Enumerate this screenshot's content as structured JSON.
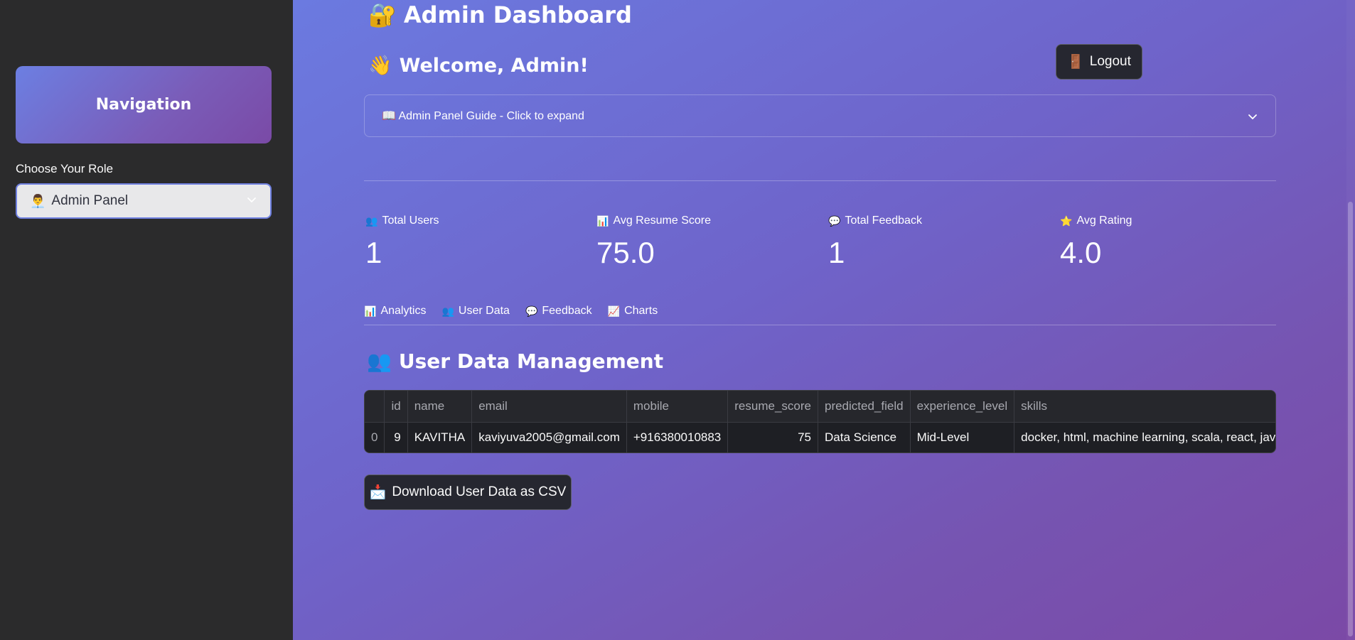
{
  "sidebar": {
    "nav_title": "Navigation",
    "role_label": "Choose Your Role",
    "role_select": {
      "icon": "👨‍💼",
      "value": "Admin Panel"
    }
  },
  "header": {
    "title_icon": "🔐",
    "title": "Admin Dashboard",
    "welcome_icon": "👋",
    "welcome": "Welcome, Admin!",
    "logout_icon": "🚪",
    "logout_label": "Logout"
  },
  "guide": {
    "label": "📖 Admin Panel Guide - Click to expand"
  },
  "metrics": [
    {
      "icon": "👥",
      "label": "Total Users",
      "value": "1"
    },
    {
      "icon": "📊",
      "label": "Avg Resume Score",
      "value": "75.0"
    },
    {
      "icon": "💬",
      "label": "Total Feedback",
      "value": "1"
    },
    {
      "icon": "⭐",
      "label": "Avg Rating",
      "value": "4.0"
    }
  ],
  "tabs": [
    {
      "icon": "📊",
      "label": "Analytics"
    },
    {
      "icon": "👥",
      "label": "User Data"
    },
    {
      "icon": "💬",
      "label": "Feedback"
    },
    {
      "icon": "📈",
      "label": "Charts"
    }
  ],
  "section": {
    "icon": "👥",
    "title": "User Data Management"
  },
  "table": {
    "columns": [
      "",
      "id",
      "name",
      "email",
      "mobile",
      "resume_score",
      "predicted_field",
      "experience_level",
      "skills"
    ],
    "rows": [
      [
        "0",
        "9",
        "KAVITHA",
        "kaviyuva2005@gmail.com",
        "+916380010883",
        "75",
        "Data Science",
        "Mid-Level",
        "docker, html, machine learning, scala, react, java, python"
      ]
    ]
  },
  "download": {
    "icon": "📩",
    "label": "Download User Data as CSV"
  },
  "colors": {
    "sidebar_bg": "#2b2b2c",
    "gradient_start": "#6b7ae0",
    "gradient_end": "#7b49a6",
    "button_bg": "#262730",
    "table_bg": "#1e1f24"
  }
}
